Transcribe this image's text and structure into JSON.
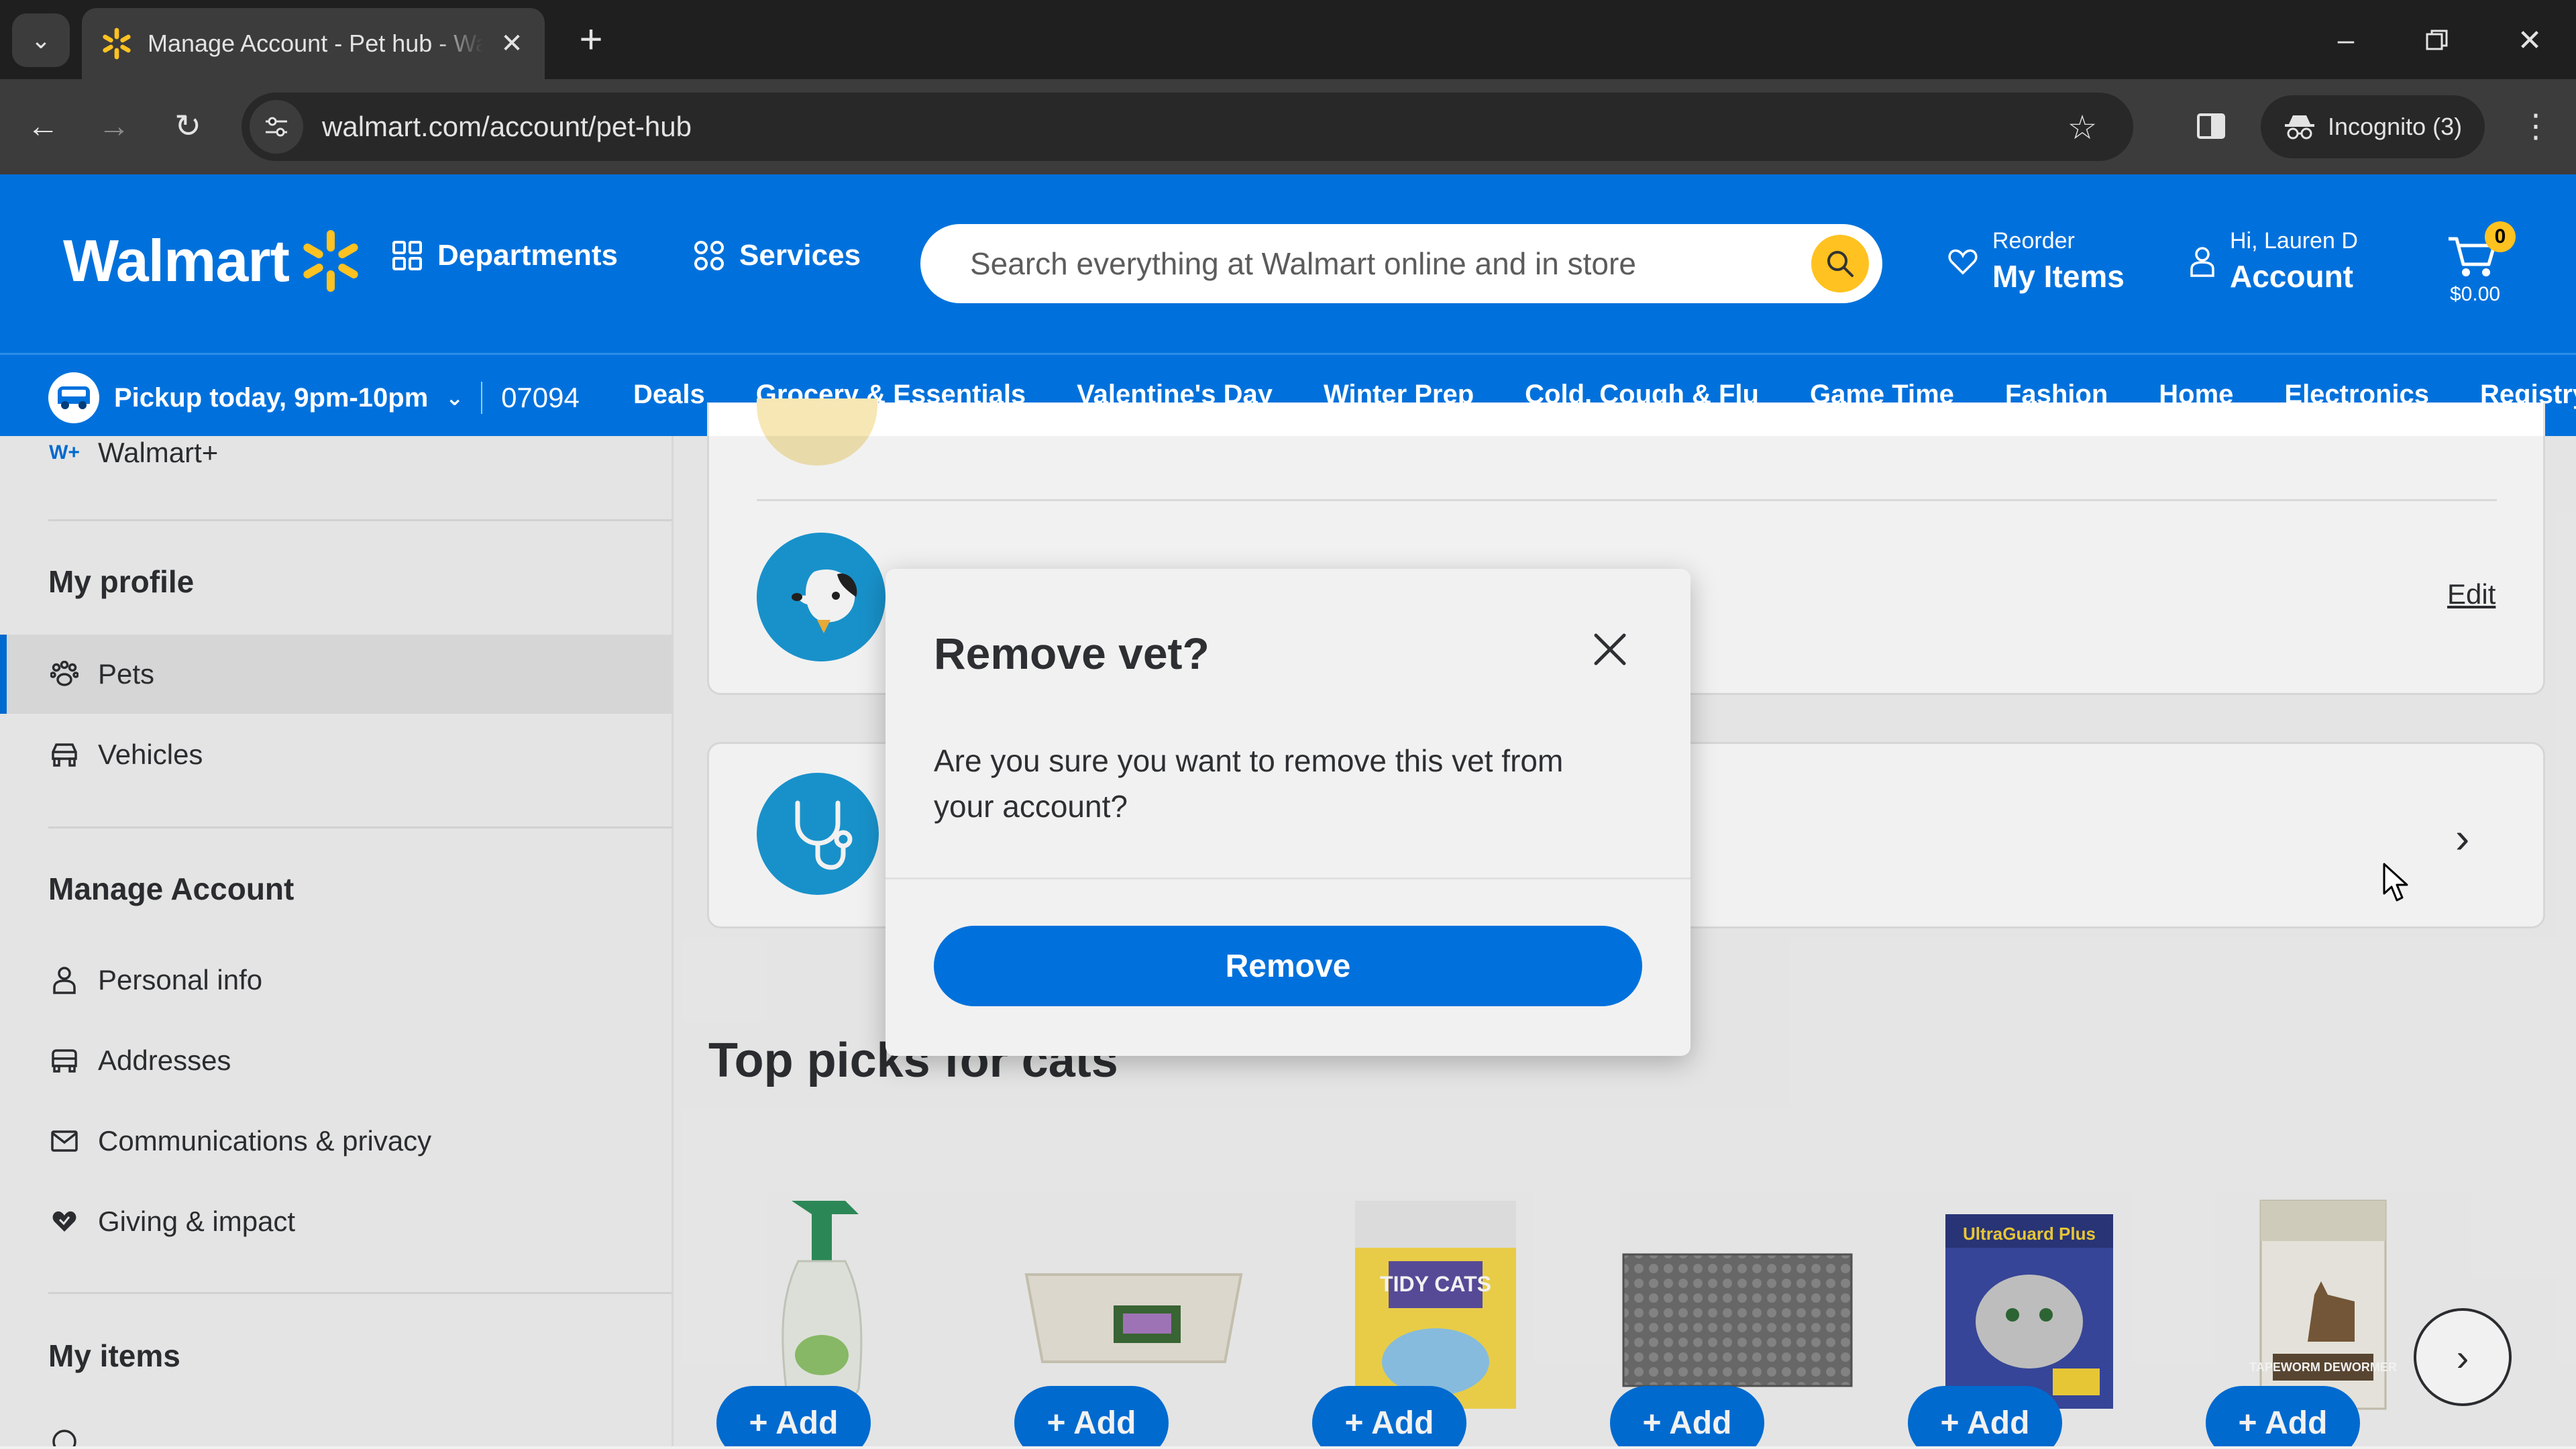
{
  "browser": {
    "tab_title": "Manage Account - Pet hub - Walmart.com",
    "url": "walmart.com/account/pet-hub",
    "incognito_label": "Incognito (3)"
  },
  "header": {
    "logo_text": "Walmart",
    "departments": "Departments",
    "services": "Services",
    "search_placeholder": "Search everything at Walmart online and in store",
    "reorder_small": "Reorder",
    "reorder_big": "My Items",
    "account_small": "Hi, Lauren D",
    "account_big": "Account",
    "cart_count": "0",
    "cart_total": "$0.00",
    "brand_color": "#0071dc",
    "spark_color": "#ffc220"
  },
  "subnav": {
    "pickup": "Pickup today, 9pm-10pm",
    "zip": "07094",
    "links": [
      "Deals",
      "Grocery & Essentials",
      "Valentine's Day",
      "Winter Prep",
      "Cold, Cough & Flu",
      "Game Time",
      "Fashion",
      "Home",
      "Electronics",
      "Registry"
    ]
  },
  "sidebar": {
    "walmart_plus": "Walmart+",
    "my_profile": "My profile",
    "pets": "Pets",
    "vehicles": "Vehicles",
    "manage_account": "Manage Account",
    "personal_info": "Personal info",
    "addresses": "Addresses",
    "communications": "Communications & privacy",
    "giving": "Giving & impact",
    "my_items": "My items"
  },
  "main": {
    "edit_label": "Edit",
    "section_title": "Top picks for cats",
    "add_label": "+ Add",
    "products": [
      {
        "icon": "spray-bottle"
      },
      {
        "icon": "litter-box"
      },
      {
        "icon": "litter-jug",
        "label": "TIDY CATS"
      },
      {
        "icon": "litter-mat"
      },
      {
        "icon": "flea-collar-box",
        "label": "UltraGuard Plus"
      },
      {
        "icon": "dewormer-box",
        "label": "TAPEWORM DEWORMER"
      }
    ]
  },
  "modal": {
    "title": "Remove vet?",
    "body": "Are you sure you want to remove this vet from your account?",
    "confirm_label": "Remove"
  }
}
